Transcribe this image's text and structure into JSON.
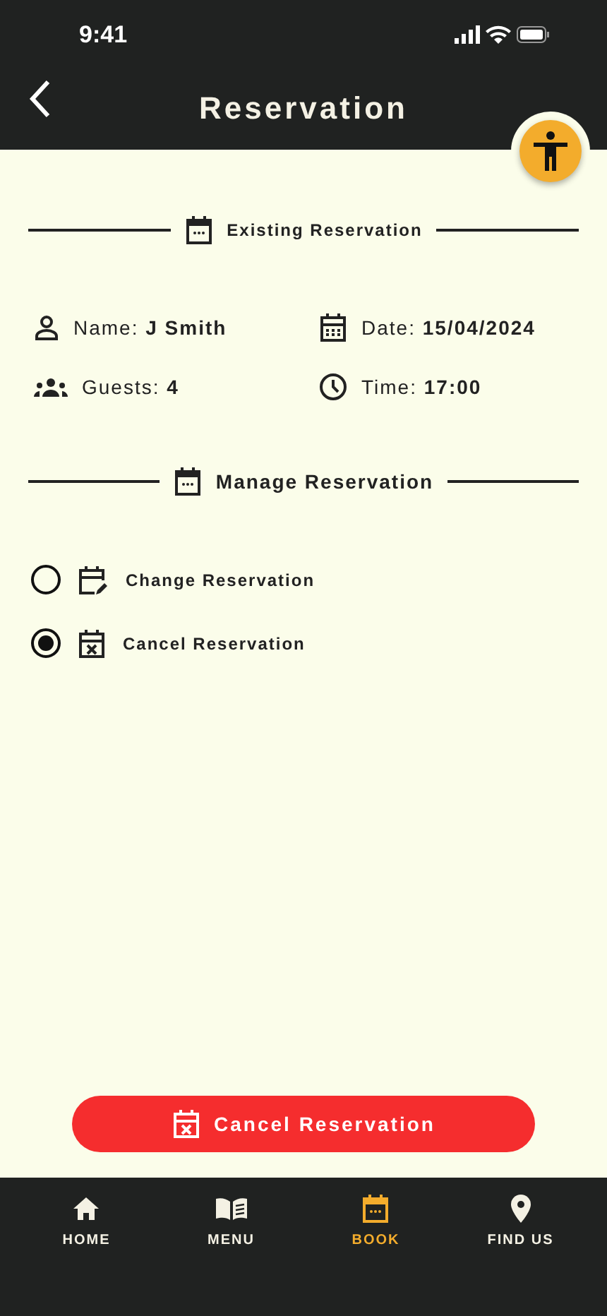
{
  "status_bar": {
    "time": "9:41"
  },
  "header": {
    "title": "Reservation"
  },
  "existing_section": {
    "title": "Existing Reservation"
  },
  "details": [
    {
      "text": "Name: **J Smith**"
    },
    {
      "text": "Date: **15/04/2024**"
    },
    {
      "text": "Guests: **4**"
    },
    {
      "text": "Time: **17:00**"
    }
  ],
  "manage_section": {
    "title": "Manage Reservation"
  },
  "options": [
    {
      "label": "Change Reservation",
      "selected": false
    },
    {
      "label": "Cancel Reservation",
      "selected": true
    }
  ],
  "action_button": {
    "label": "Cancel Reservation"
  },
  "nav": [
    {
      "label": "HOME",
      "selected": false
    },
    {
      "label": "MENU",
      "selected": false
    },
    {
      "label": "BOOK",
      "selected": true
    },
    {
      "label": "FIND US",
      "selected": false
    }
  ]
}
